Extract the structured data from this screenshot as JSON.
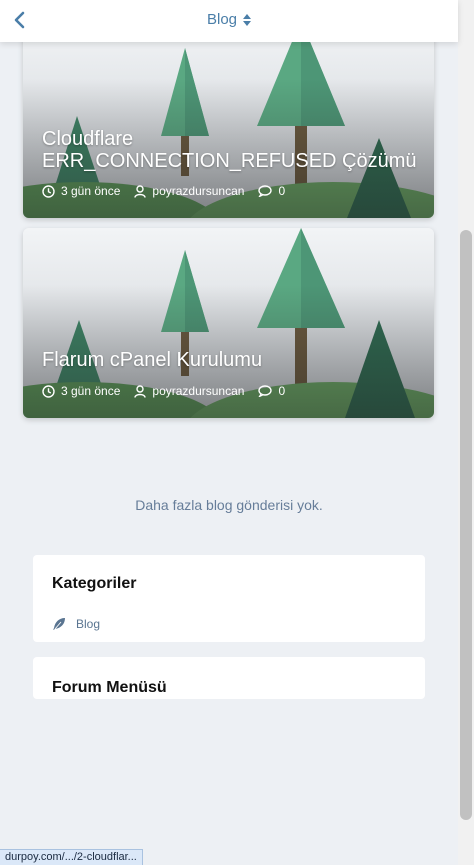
{
  "header": {
    "title": "Blog",
    "back_icon": "chevron-left-icon",
    "sort_icon": "sort-icon"
  },
  "posts": [
    {
      "title": "Cloudflare ERR_CONNECTION_REFUSED Çözümü",
      "time": "3 gün önce",
      "author": "poyrazdursuncan",
      "comments": "0"
    },
    {
      "title": "Flarum cPanel Kurulumu",
      "time": "3 gün önce",
      "author": "poyrazdursuncan",
      "comments": "0"
    }
  ],
  "no_more_text": "Daha fazla blog gönderisi yok.",
  "categories": {
    "heading": "Kategoriler",
    "items": [
      {
        "label": "Blog",
        "icon": "feather-icon"
      }
    ]
  },
  "forum_menu": {
    "heading": "Forum Menüsü"
  },
  "status_bar": {
    "url": "durpoy.com/.../2-cloudflar..."
  },
  "colors": {
    "accent": "#4a7ea8",
    "background": "#edf0f4",
    "tree": "#5aa882",
    "tree_dark": "#2f6b52",
    "hill": "#5c9a5a"
  }
}
